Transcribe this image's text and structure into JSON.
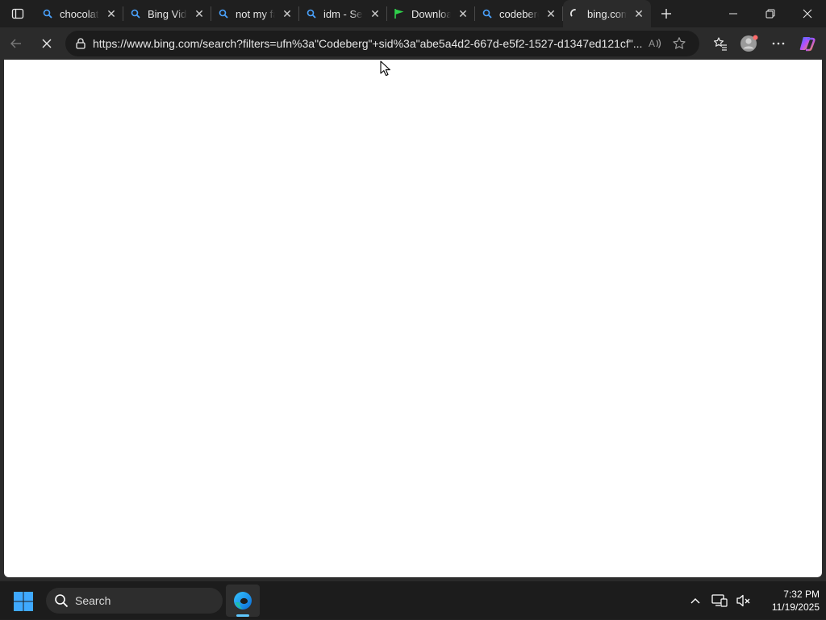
{
  "browser": {
    "tabs": [
      {
        "title": "chocolate",
        "icon": "search-icon",
        "active": false
      },
      {
        "title": "Bing Videos",
        "icon": "search-icon",
        "active": false
      },
      {
        "title": "not my fault",
        "icon": "search-icon",
        "active": false
      },
      {
        "title": "idm - Search",
        "icon": "search-icon",
        "active": false
      },
      {
        "title": "Download",
        "icon": "green-flag-icon",
        "active": false
      },
      {
        "title": "codeberg",
        "icon": "search-icon",
        "active": false
      },
      {
        "title": "bing.com",
        "icon": "loading-spinner-icon",
        "active": true
      }
    ],
    "address_bar": {
      "url": "https://www.bing.com/search?filters=ufn%3a\"Codeberg\"+sid%3a\"abe5a4d2-667d-e5f2-1527-d1347ed121cf\"..."
    }
  },
  "taskbar": {
    "search_label": "Search",
    "time": "7:32 PM",
    "date": "11/19/2025"
  },
  "colors": {
    "accent": "#60c8ff",
    "tab_search_icon": "#4aa3ff",
    "flag_green": "#2fd14b"
  }
}
